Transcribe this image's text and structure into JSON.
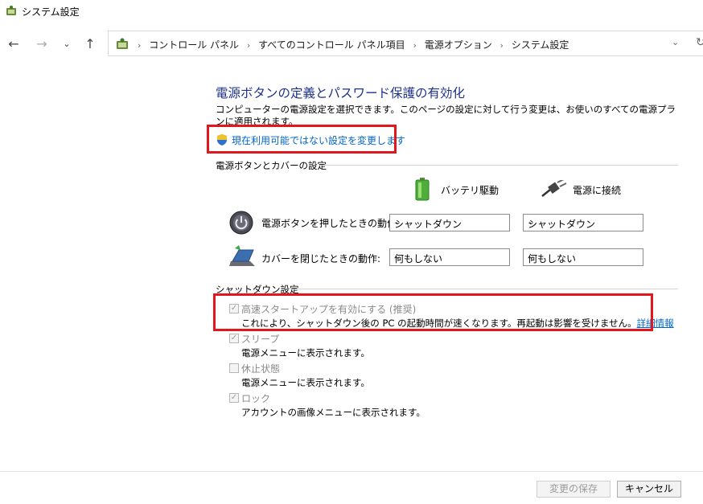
{
  "window": {
    "title": "システム設定"
  },
  "nav": {
    "back_icon": "arrow-left-icon",
    "forward_icon": "arrow-right-icon",
    "recent_icon": "chevron-down-icon",
    "up_icon": "arrow-up-icon"
  },
  "address": {
    "breadcrumbs": [
      "コントロール パネル",
      "すべてのコントロール パネル項目",
      "電源オプション",
      "システム設定"
    ]
  },
  "page": {
    "heading": "電源ボタンの定義とパスワード保護の有効化",
    "description": "コンピューターの電源設定を選択できます。このページの設定に対して行う変更は、お使いのすべての電源プランに適用されます。",
    "change_link": "現在利用可能ではない設定を変更します"
  },
  "power_section": {
    "title": "電源ボタンとカバーの設定",
    "col_battery": "バッテリ駆動",
    "col_plugged": "電源に接続",
    "rows": [
      {
        "label": "電源ボタンを押したときの動作:",
        "battery": "シャットダウン",
        "plugged": "シャットダウン"
      },
      {
        "label": "カバーを閉じたときの動作:",
        "battery": "何もしない",
        "plugged": "何もしない"
      }
    ]
  },
  "shutdown_section": {
    "title": "シャットダウン設定",
    "items": [
      {
        "label": "高速スタートアップを有効にする (推奨)",
        "desc": "これにより、シャットダウン後の PC の起動時間が速くなります。再起動は影響を受けません。",
        "link": "詳細情報",
        "checked": true
      },
      {
        "label": "スリープ",
        "desc": "電源メニューに表示されます。",
        "checked": true
      },
      {
        "label": "休止状態",
        "desc": "電源メニューに表示されます。",
        "checked": false
      },
      {
        "label": "ロック",
        "desc": "アカウントの画像メニューに表示されます。",
        "checked": true
      }
    ]
  },
  "footer": {
    "save": "変更の保存",
    "cancel": "キャンセル"
  },
  "colors": {
    "heading": "#1e3287",
    "link": "#0066cc",
    "highlight": "#e3151d"
  }
}
